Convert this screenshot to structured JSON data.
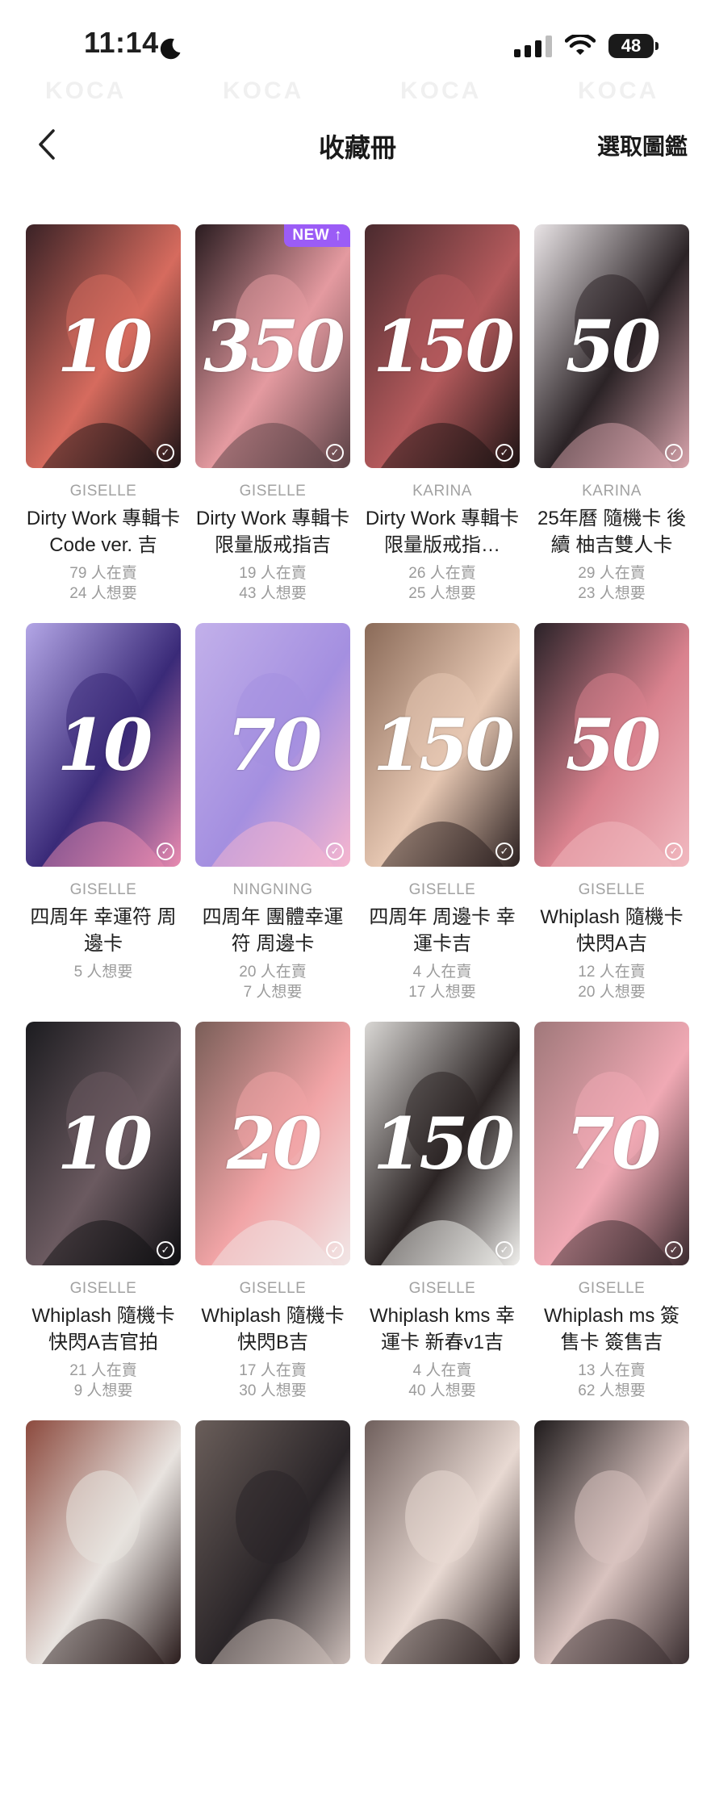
{
  "status_bar": {
    "time": "11:14",
    "battery": "48",
    "icons": [
      "moon-icon",
      "signal-icon",
      "wifi-icon",
      "battery-icon"
    ]
  },
  "header": {
    "title": "收藏冊",
    "action_label": "選取圖鑑",
    "back_icon": "chevron-left-icon"
  },
  "watermark": "KOCA",
  "cards": [
    {
      "artist": "GISELLE",
      "title": "Dirty Work 專輯卡 Code ver. 吉",
      "stats": [
        "79 人在賣",
        "24 人想要"
      ],
      "overlay": "10",
      "colors": [
        "#3a2226",
        "#d66b5e",
        "#1d1416"
      ]
    },
    {
      "artist": "GISELLE",
      "title": "Dirty Work 專輯卡 限量版戒指吉",
      "stats": [
        "19 人在賣",
        "43 人想要"
      ],
      "overlay": "350",
      "badge": "NEW ↑",
      "colors": [
        "#2a1c20",
        "#e49aa0",
        "#5a4145"
      ]
    },
    {
      "artist": "KARINA",
      "title": "Dirty Work 專輯卡 限量版戒指…",
      "stats": [
        "26 人在賣",
        "25 人想要"
      ],
      "overlay": "150",
      "colors": [
        "#4a2a2e",
        "#b45a5c",
        "#1e1414"
      ]
    },
    {
      "artist": "KARINA",
      "title": "25年曆 隨機卡 後續 柚吉雙人卡",
      "stats": [
        "29 人在賣",
        "23 人想要"
      ],
      "overlay": "50",
      "colors": [
        "#e9e4e6",
        "#2b2326",
        "#d8a4ac"
      ]
    },
    {
      "artist": "GISELLE",
      "title": "四周年 幸運符 周邊卡",
      "stats": [
        "5 人想要"
      ],
      "overlay": "10",
      "colors": [
        "#b3a6e6",
        "#3a2a78",
        "#e98bb0"
      ]
    },
    {
      "artist": "NINGNING",
      "title": "四周年 團體幸運符 周邊卡",
      "stats": [
        "20 人在賣",
        "7 人想要"
      ],
      "overlay": "70",
      "colors": [
        "#c2b0ea",
        "#a48fe0",
        "#f6b6cf"
      ]
    },
    {
      "artist": "GISELLE",
      "title": "四周年 周邊卡 幸運卡吉",
      "stats": [
        "4 人在賣",
        "17 人想要"
      ],
      "overlay": "150",
      "colors": [
        "#8a6a58",
        "#e6c7b2",
        "#2b2020"
      ]
    },
    {
      "artist": "GISELLE",
      "title": "Whiplash 隨機卡 快閃A吉",
      "stats": [
        "12 人在賣",
        "20 人想要"
      ],
      "overlay": "50",
      "colors": [
        "#2a2228",
        "#d9828e",
        "#f1b9c0"
      ]
    },
    {
      "artist": "GISELLE",
      "title": "Whiplash 隨機卡 快閃A吉官拍",
      "stats": [
        "21 人在賣",
        "9 人想要"
      ],
      "overlay": "10",
      "colors": [
        "#1c1c20",
        "#6b5a60",
        "#0f0f12"
      ]
    },
    {
      "artist": "GISELLE",
      "title": "Whiplash 隨機卡 快閃B吉",
      "stats": [
        "17 人在賣",
        "30 人想要"
      ],
      "overlay": "20",
      "colors": [
        "#7a5e58",
        "#f1a4a6",
        "#f1e6e6"
      ]
    },
    {
      "artist": "GISELLE",
      "title": "Whiplash kms 幸運卡 新春v1吉",
      "stats": [
        "4 人在賣",
        "40 人想要"
      ],
      "overlay": "150",
      "colors": [
        "#d9d7d4",
        "#2b2424",
        "#f0efec"
      ]
    },
    {
      "artist": "GISELLE",
      "title": "Whiplash ms 簽售卡 簽售吉",
      "stats": [
        "13 人在賣",
        "62 人想要"
      ],
      "overlay": "70",
      "colors": [
        "#a0787a",
        "#f0a9b4",
        "#3a2a2e"
      ]
    },
    {
      "artist": "",
      "title": "",
      "stats": [],
      "overlay": "",
      "colors": [
        "#8c4a3e",
        "#e8e3df",
        "#2a1c1c"
      ]
    },
    {
      "artist": "",
      "title": "",
      "stats": [],
      "overlay": "",
      "colors": [
        "#6a5e5a",
        "#2a2528",
        "#cdbfba"
      ]
    },
    {
      "artist": "",
      "title": "",
      "stats": [],
      "overlay": "",
      "colors": [
        "#6f5f5c",
        "#e8d9d2",
        "#2a1f1f"
      ]
    },
    {
      "artist": "",
      "title": "",
      "stats": [],
      "overlay": "",
      "colors": [
        "#1f1b1c",
        "#d9c3bf",
        "#3a2e30"
      ]
    }
  ]
}
